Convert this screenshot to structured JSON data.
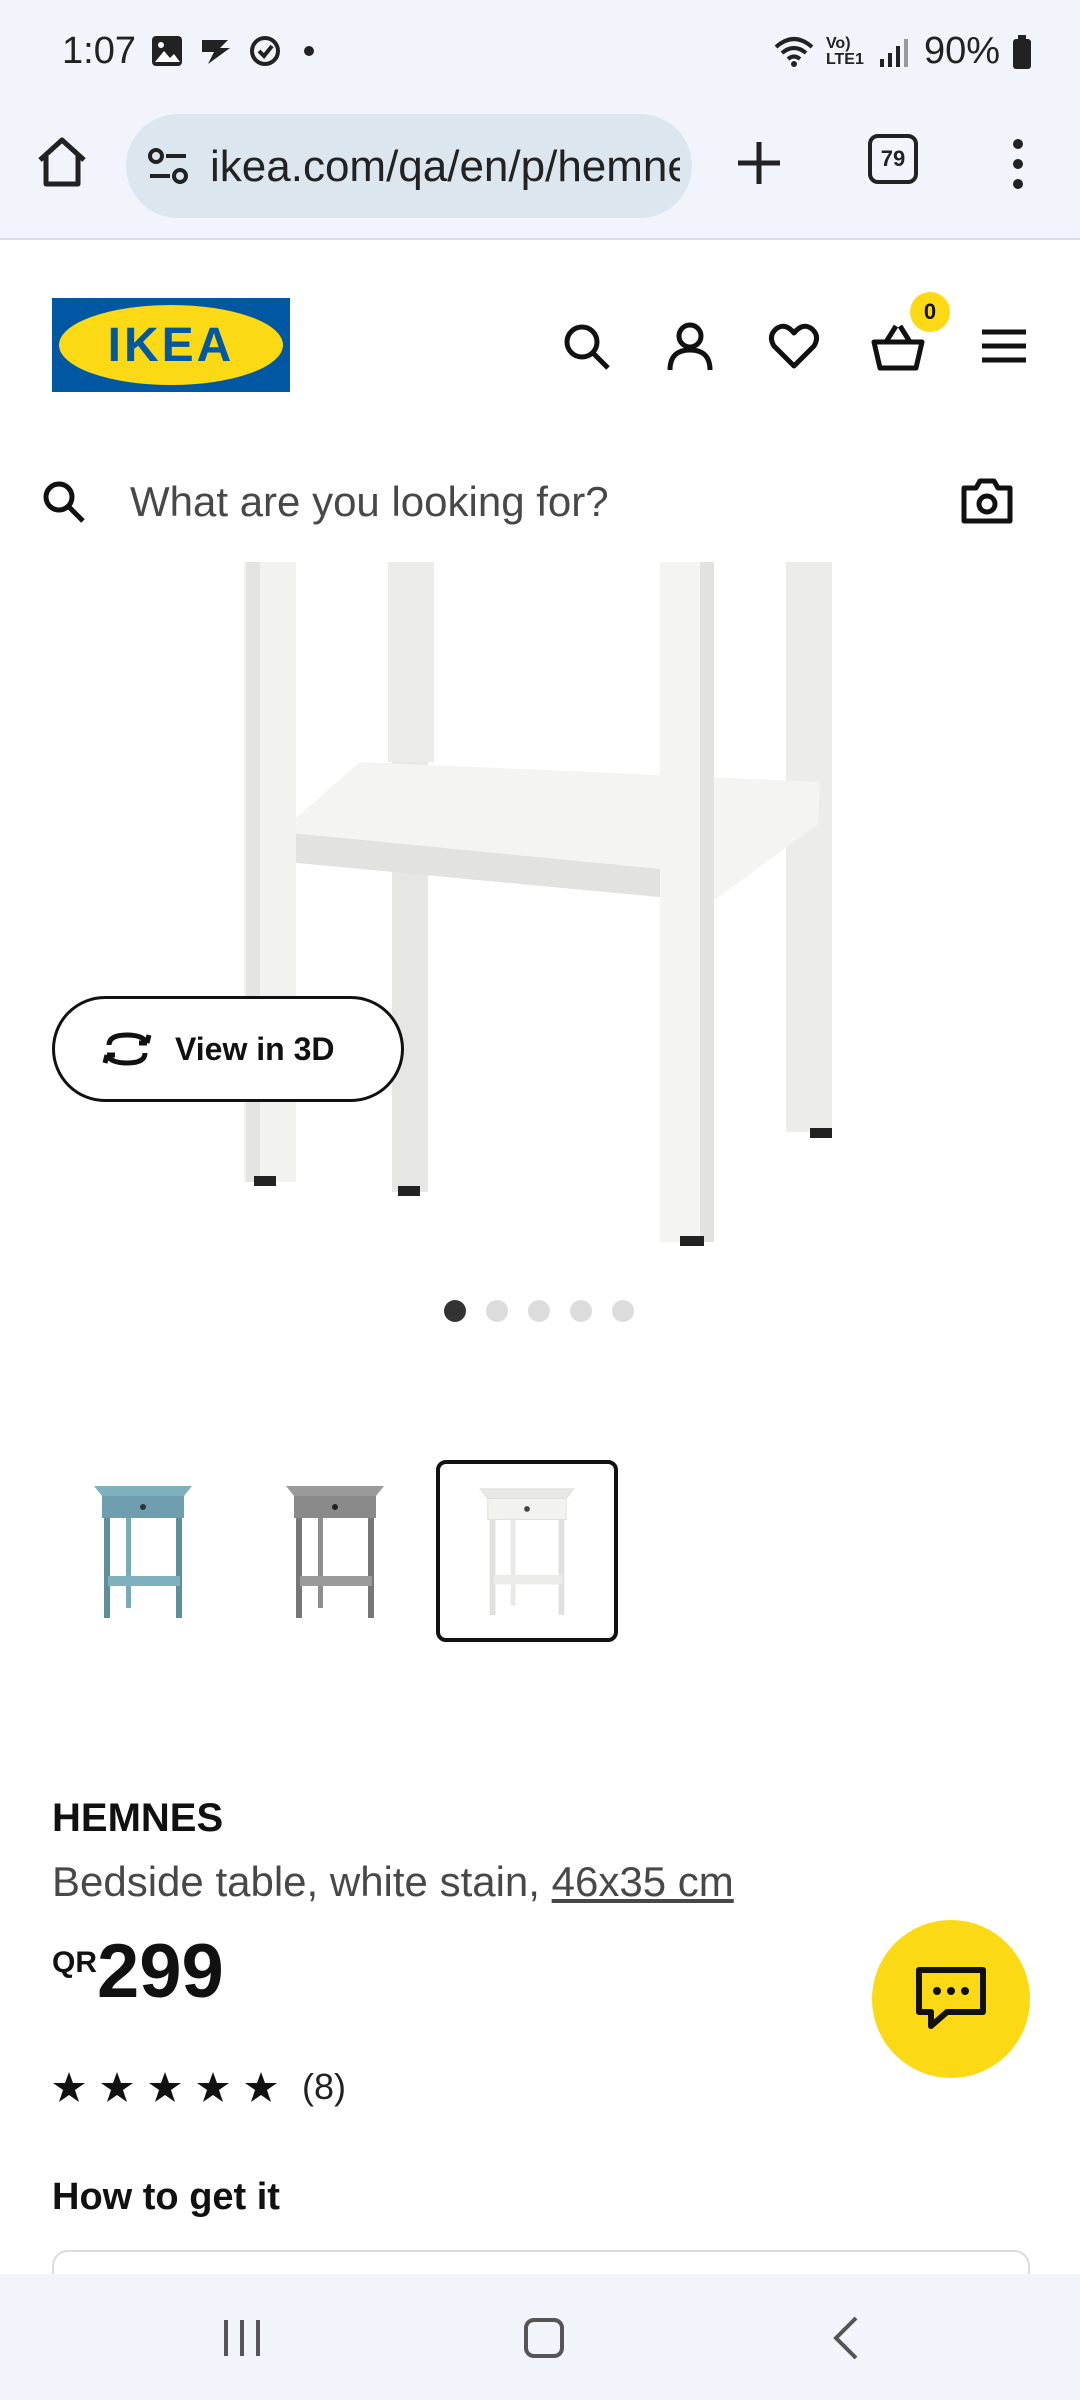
{
  "status_bar": {
    "time": "1:07",
    "battery": "90%",
    "signal_text": "Vo) LTE1"
  },
  "browser": {
    "url": "ikea.com/qa/en/p/hemnes",
    "tab_count": "79"
  },
  "header": {
    "logo_text": "IKEA",
    "cart_count": "0"
  },
  "search": {
    "placeholder": "What are you looking for?"
  },
  "gallery": {
    "view_3d_label": "View in 3D",
    "dots_total": 5,
    "active_dot": 1
  },
  "thumbnails": [
    {
      "color": "#6f9fae",
      "label": "blue"
    },
    {
      "color": "#8a8a8a",
      "label": "grey"
    },
    {
      "color": "#f2f2f0",
      "label": "white",
      "selected": true
    }
  ],
  "product": {
    "name": "HEMNES",
    "description": "Bedside table, white stain, ",
    "dimensions": "46x35 cm",
    "currency": "QR",
    "price": "299",
    "rating": 5,
    "review_count": "(8)"
  },
  "delivery": {
    "heading": "How to get it"
  },
  "colors": {
    "ikea_blue": "#0058a3",
    "ikea_yellow": "#fbd914"
  }
}
